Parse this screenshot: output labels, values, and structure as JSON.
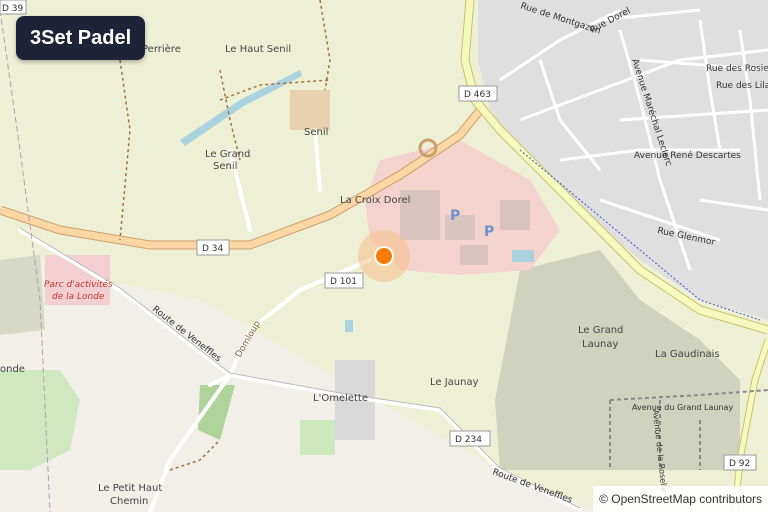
{
  "title": "3Set Padel",
  "attribution": "© OpenStreetMap contributors",
  "marker": {
    "color": "#f57c00",
    "halo": "#f5c08a"
  },
  "roads": {
    "d39": "D 39",
    "d463": "D 463",
    "d34": "D 34",
    "d101": "D 101",
    "d234": "D 234",
    "d92": "D 92"
  },
  "places": {
    "perriere": "Perrière",
    "haut_senil": "Le Haut Senil",
    "senil": "Senil",
    "grand_senil_1": "Le Grand",
    "grand_senil_2": "Senil",
    "croix_dorel": "La Croix Dorel",
    "zone_1": "Parc d'activités",
    "zone_2": "de la Londe",
    "jaunay": "Le Jaunay",
    "omelette": "L'Omelette",
    "grand_launay_1": "Le Grand",
    "grand_launay_2": "Launay",
    "gaudinais": "La Gaudinais",
    "petit_haut_1": "Le Petit Haut",
    "petit_haut_2": "Chemin",
    "londe_partial": "onde"
  },
  "streets": {
    "montgazon": "Rue de Montgazon",
    "dorel": "Rue Dorel",
    "rosiers": "Rue des Rosiers",
    "lilas": "Rue des Lilas",
    "leclerc": "Avenue Maréchal Leclerc",
    "descartes": "Avenue René Descartes",
    "glenmor": "Rue Glenmor",
    "veneffles_1": "Route de Veneffles",
    "veneffles_2": "Route de Veneffles",
    "domloup": "Domloup",
    "grand_launay_av": "Avenue du Grand Launay",
    "roselie": "Avenue de la Roselie"
  },
  "parking": "P"
}
